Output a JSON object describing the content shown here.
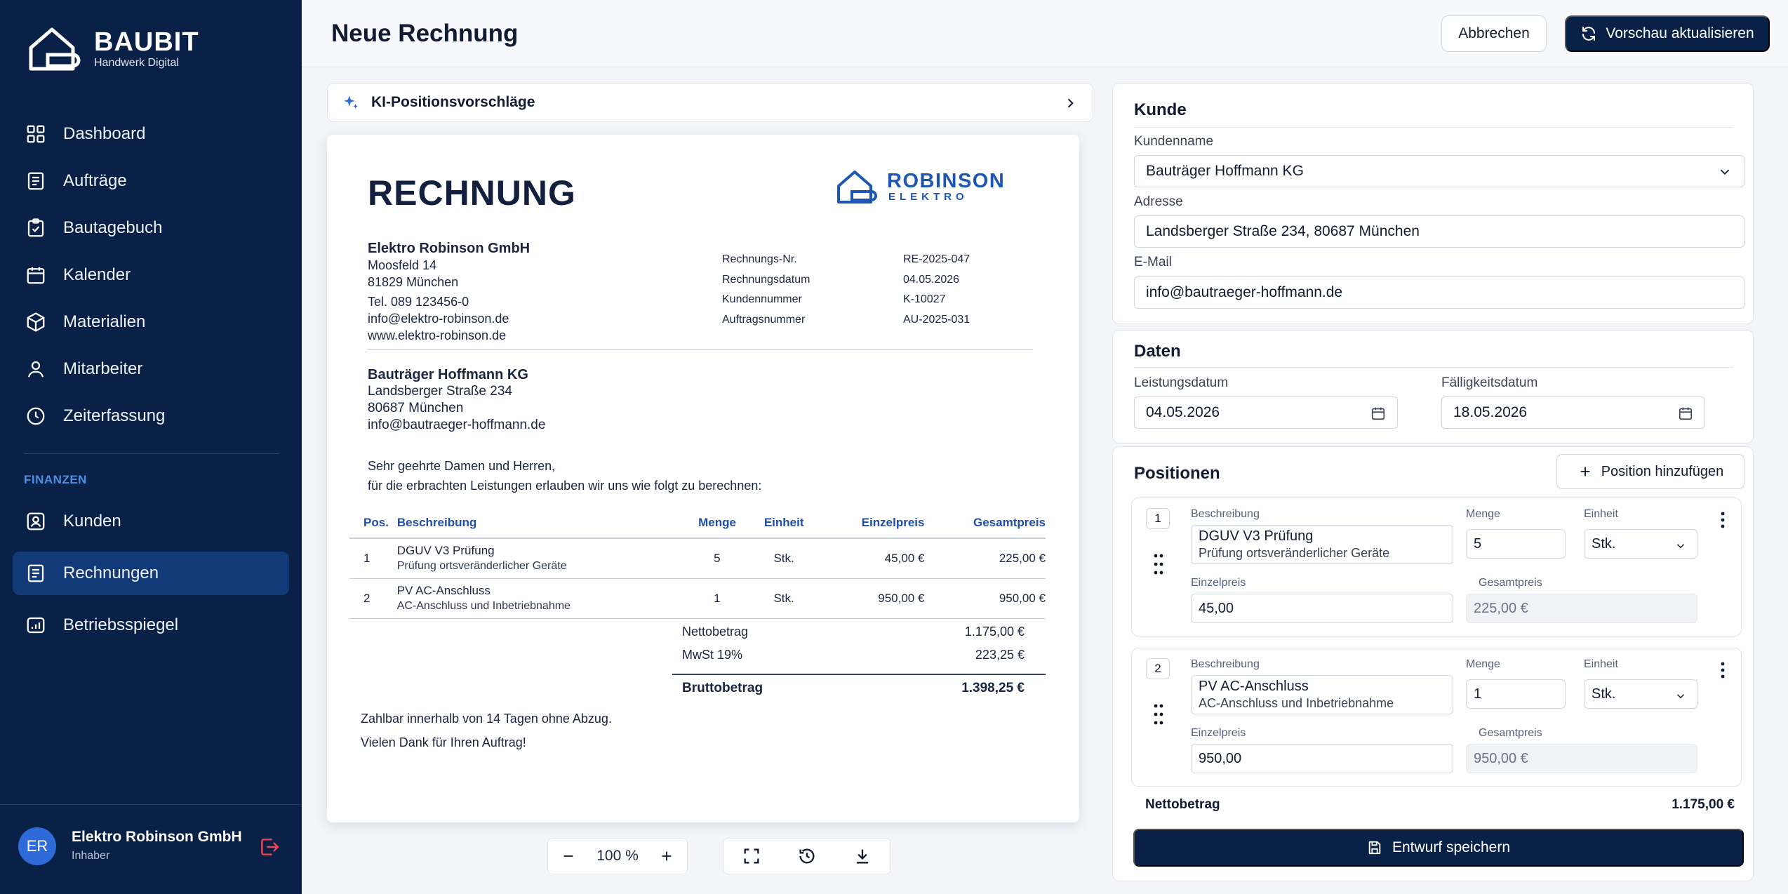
{
  "brand": {
    "name": "BAUBIT",
    "subtitle": "Handwerk Digital"
  },
  "nav": {
    "main": [
      {
        "label": "Dashboard",
        "icon": "grid-icon"
      },
      {
        "label": "Aufträge",
        "icon": "clipboard-list-icon"
      },
      {
        "label": "Bautagebuch",
        "icon": "clipboard-check-icon"
      },
      {
        "label": "Kalender",
        "icon": "calendar-icon"
      },
      {
        "label": "Materialien",
        "icon": "box-icon"
      },
      {
        "label": "Mitarbeiter",
        "icon": "user-icon"
      },
      {
        "label": "Zeiterfassung",
        "icon": "clock-icon"
      }
    ],
    "section_label": "FINANZEN",
    "finance": [
      {
        "label": "Kunden",
        "icon": "user-card-icon"
      },
      {
        "label": "Rechnungen",
        "icon": "invoice-icon",
        "active": true
      },
      {
        "label": "Betriebsspiegel",
        "icon": "dashboard-icon"
      }
    ]
  },
  "user": {
    "initials": "ER",
    "name": "Elektro Robinson GmbH",
    "role": "Inhaber"
  },
  "header": {
    "title": "Neue Rechnung",
    "cancel_label": "Abbrechen",
    "refresh_label": "Vorschau aktualisieren"
  },
  "ai": {
    "label": "KI-Positionsvorschläge"
  },
  "invoice": {
    "title": "RECHNUNG",
    "logo_name": "ROBINSON",
    "logo_sub": "ELEKTRO",
    "sender": {
      "company": "Elektro Robinson GmbH",
      "street": "Moosfeld 14",
      "city": "81829 München",
      "phone": "Tel. 089 123456-0",
      "email": "info@elektro-robinson.de",
      "web": "www.elektro-robinson.de"
    },
    "meta": [
      {
        "key": "Rechnungs-Nr.",
        "value": "RE-2025-047"
      },
      {
        "key": "Rechnungsdatum",
        "value": "04.05.2026"
      },
      {
        "key": "Kundennummer",
        "value": "K-10027"
      },
      {
        "key": "Auftragsnummer",
        "value": "AU-2025-031"
      }
    ],
    "recipient": {
      "company": "Bauträger Hoffmann KG",
      "street": "Landsberger Straße 234",
      "city": "80687 München",
      "email": "info@bautraeger-hoffmann.de"
    },
    "greeting": "Sehr geehrte Damen und Herren,",
    "intro": "für die erbrachten Leistungen erlauben wir uns wie folgt zu berechnen:",
    "columns": [
      "Pos.",
      "Beschreibung",
      "Menge",
      "Einheit",
      "Einzelpreis",
      "Gesamtpreis"
    ],
    "rows": [
      {
        "pos": "1",
        "title": "DGUV V3 Prüfung",
        "sub": "Prüfung ortsveränderlicher Geräte",
        "qty": "5",
        "unit": "Stk.",
        "unit_price": "45,00 €",
        "total": "225,00 €"
      },
      {
        "pos": "2",
        "title": "PV AC-Anschluss",
        "sub": "AC-Anschluss und Inbetriebnahme",
        "qty": "1",
        "unit": "Stk.",
        "unit_price": "950,00 €",
        "total": "950,00 €"
      }
    ],
    "totals": {
      "net_label": "Nettobetrag",
      "net": "1.175,00 €",
      "vat_label": "MwSt 19%",
      "vat": "223,25 €",
      "gross_label": "Bruttobetrag",
      "gross": "1.398,25 €"
    },
    "payment_note": "Zahlbar innerhalb von 14 Tagen ohne Abzug.",
    "thanks": "Vielen Dank für Ihren Auftrag!"
  },
  "zoom": {
    "value": "100 %"
  },
  "form": {
    "customer": {
      "title": "Kunde",
      "name_label": "Kundenname",
      "name": "Bauträger Hoffmann KG",
      "address_label": "Adresse",
      "address": "Landsberger Straße 234, 80687 München",
      "email_label": "E-Mail",
      "email": "info@bautraeger-hoffmann.de"
    },
    "dates": {
      "title": "Daten",
      "service_label": "Leistungsdatum",
      "service": "04.05.2026",
      "due_label": "Fälligkeitsdatum",
      "due": "18.05.2026"
    },
    "positions": {
      "title": "Positionen",
      "add_label": "Position hinzufügen",
      "labels": {
        "desc": "Beschreibung",
        "qty": "Menge",
        "unit": "Einheit",
        "unit_price": "Einzelpreis",
        "total": "Gesamtpreis"
      },
      "items": [
        {
          "num": "1",
          "title": "DGUV V3 Prüfung",
          "sub": "Prüfung ortsveränderlicher Geräte",
          "qty": "5",
          "unit": "Stk.",
          "unit_price": "45,00",
          "total": "225,00 €"
        },
        {
          "num": "2",
          "title": "PV AC-Anschluss",
          "sub": "AC-Anschluss und Inbetriebnahme",
          "qty": "1",
          "unit": "Stk.",
          "unit_price": "950,00",
          "total": "950,00 €"
        }
      ],
      "net_label": "Nettobetrag",
      "net": "1.175,00 €"
    },
    "save_label": "Entwurf speichern"
  }
}
